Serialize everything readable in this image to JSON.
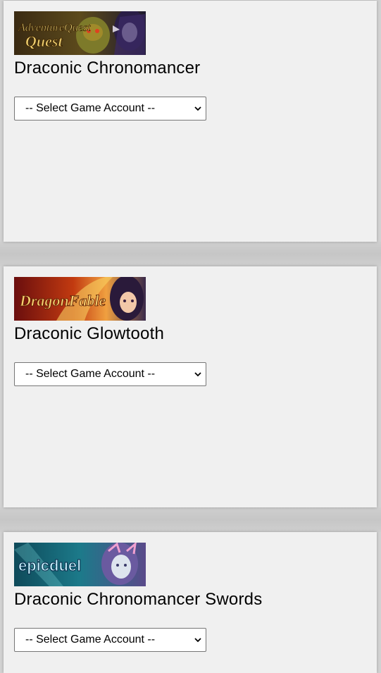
{
  "items": [
    {
      "title": "Draconic Chronomancer",
      "logo_text": "AdventureQuest",
      "logo_icon": "adventurequest-logo",
      "select": {
        "selected": "-- Select Game Account --"
      }
    },
    {
      "title": "Draconic Glowtooth",
      "logo_text": "DragonFable",
      "logo_icon": "dragonfable-logo",
      "select": {
        "selected": "-- Select Game Account --"
      }
    },
    {
      "title": "Draconic Chronomancer Swords",
      "logo_text": "epicduel",
      "logo_icon": "epicduel-logo",
      "select": {
        "selected": "-- Select Game Account --"
      }
    }
  ],
  "colors": {
    "card_bg": "#f0f0f0",
    "gutter": "#cccccc"
  }
}
